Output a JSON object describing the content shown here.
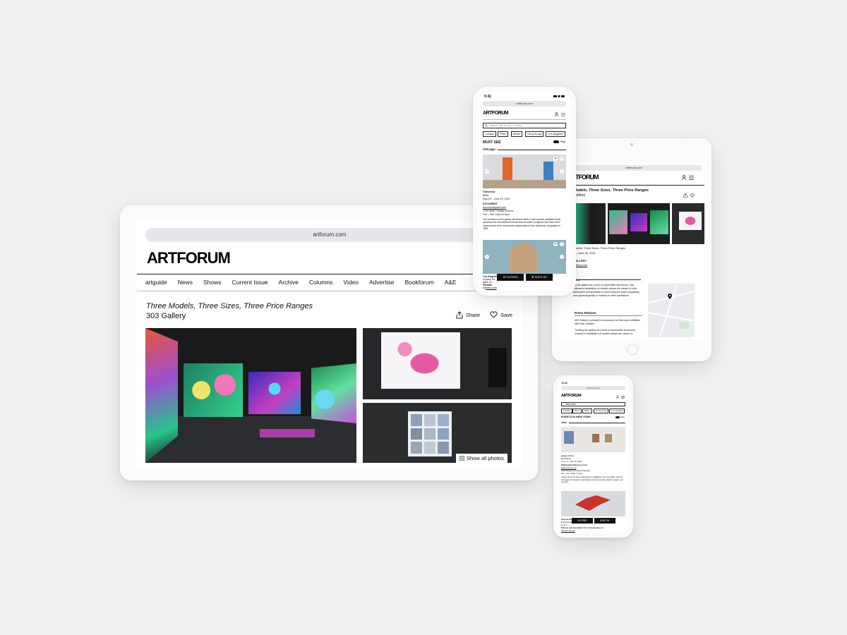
{
  "laptop": {
    "url": "artforum.com",
    "logo": "ARTFORUM",
    "nav": [
      "artguide",
      "News",
      "Shows",
      "Current Issue",
      "Archive",
      "Columns",
      "Video",
      "Advertise",
      "Bookforum",
      "A&E"
    ],
    "show_title": "Three Models, Three Sizes, Three Price Ranges",
    "venue": "303 Gallery",
    "share_label": "Share",
    "save_label": "Save",
    "show_all_photos": "Show all photos"
  },
  "phone_top": {
    "time": "9:41",
    "url": "artforum.com",
    "logo": "ARTFORUM",
    "search_placeholder": "Search city, venue, or artist",
    "cities": [
      "London",
      "Paris",
      "Berlin",
      "Hong Kong",
      "Los Angeles"
    ],
    "section_title": "MUST SEE",
    "map_toggle": "Map",
    "city_heading": "Chicago",
    "listing1": {
      "title": "Tomorrow",
      "artist": "Bélia",
      "dates": "May 10 – June 19, 2021",
      "venue": "DOCUMENT",
      "link": "documentspace.com",
      "address": "1709 West Chicago avenue",
      "hours": "Tue – Sat, 12pm to 6pm",
      "desc": "The exhibition at the gallery will feature Bélia, a site-specific installation that questions the standardized elementary education programs that have been implemented since Indonesia's independence from Japanese occupation in 1945."
    },
    "listing2": {
      "title": "Los Angeles",
      "line1": "A place for",
      "line2": "April 23 – ",
      "venue": "Paradis",
      "link": "paradis.com"
    },
    "filters_label": "FILTERS",
    "sort_label": "SORT BY"
  },
  "tablet": {
    "url": "artforum.com",
    "logo": "ARTFORUM",
    "title": "Models, Three Sizes, Three Price Ranges",
    "venue": "Gallery",
    "info_title": "Models, Three Sizes, Three Price Ranges",
    "info_dates": "7 – June 26, 2021",
    "info_gallery": "GALLERY",
    "info_link": "gallery.com",
    "overview_heading": "view",
    "overview_text": "ing the gallery as a kind of automobile showroom, Dan Graham's installation of models allows the viewer to both participant and spectator in perceiving the space physically and psychologically in relation to other spectators.",
    "press_heading": "Press Release",
    "press_text1": "303 Gallery is pleased to announce our first solo exhibition with Dan Graham.",
    "press_text2": "Treating the gallery as a kind of automobile showroom, Graham's installation of models allows the viewer to"
  },
  "phone_bottom": {
    "time": "9:41",
    "url": "artforum.com",
    "logo": "ARTFORUM",
    "city_value": "New York",
    "cities": [
      "London",
      "Paris",
      "Berlin",
      "Hong Kong",
      "Los Angeles"
    ],
    "section_title": "EVENTS IN NEW YORK",
    "map_toggle": "Map",
    "date_heading": "June",
    "listing1": {
      "artist": "Jasper Johns",
      "show": "Mind/Mirror",
      "dates": "June 11 – Dec 19, 2021",
      "venue": "Philadelphia Museum of Art",
      "link": "philamuseum.org",
      "address": "2600 Benjamin Franklin Parkway",
      "hours": "Sat – Sun, 10am to 5pm",
      "desc": "Jasper Johns has been celebrated as a trailblazer since the 1950s, when he first began his signature appropriation of commonplace objects, images, and symbols."
    },
    "listing2": {
      "artist": "Pascale Feier",
      "show": "Protoseplikes",
      "line": "June 2 – ",
      "venue": "Parasol unit foundation for contemporary art",
      "link": "parasol-unit.org"
    },
    "filters_label": "FILTERS",
    "sort_label": "SORT BY"
  },
  "colors": {
    "background": "#eef0f2",
    "device_frame": "#fbfbfc",
    "text": "#111111",
    "url_bar": "#e5e7ea",
    "button_dark": "#111111"
  },
  "icons": [
    "share-icon",
    "heart-icon",
    "grid-icon",
    "user-icon",
    "menu-icon",
    "search-icon",
    "heart-icon",
    "plus-icon",
    "chevron-left-icon",
    "chevron-right-icon",
    "filter-icon",
    "sort-icon",
    "map-pin-icon",
    "toggle-icon"
  ]
}
